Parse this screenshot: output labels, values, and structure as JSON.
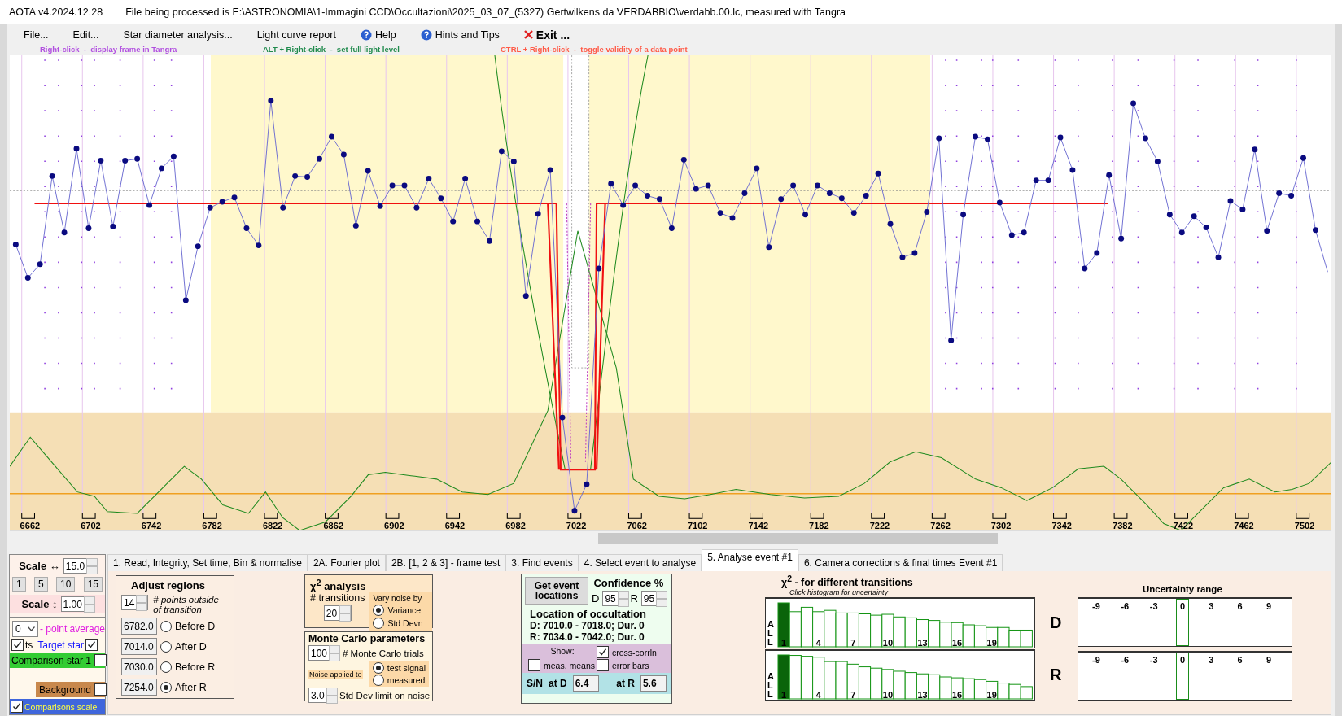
{
  "window": {
    "app": "AOTA v4.2024.12.28",
    "title": "File being processed is E:\\ASTRONOMIA\\1-Immagini CCD\\Occultazioni\\2025_03_07_(5327) Gertwilkens da VERDABBIO\\verdabb.00.lc, measured with Tangra"
  },
  "menu": [
    {
      "label": "File...",
      "kind": "plain"
    },
    {
      "label": "Edit...",
      "kind": "plain"
    },
    {
      "label": "Star diameter analysis...",
      "kind": "plain"
    },
    {
      "label": "Light curve report",
      "kind": "plain"
    },
    {
      "label": "Help",
      "kind": "help"
    },
    {
      "label": "Hints and Tips",
      "kind": "help"
    },
    {
      "label": "Exit ...",
      "kind": "exit"
    }
  ],
  "hints": [
    {
      "text": "Right-click  -  display frame in Tangra",
      "color": "#b14fe0"
    },
    {
      "text": "ALT + Right-click  -  set full light level",
      "color": "#1f8a4c"
    },
    {
      "text": "CTRL + Right-click  -  toggle validity of a data point",
      "color": "#ff5a47"
    }
  ],
  "plot": {
    "x_tick_labels": [
      "6662",
      "6702",
      "6742",
      "6782",
      "6822",
      "6862",
      "6902",
      "6942",
      "6982",
      "7022",
      "7062",
      "7102",
      "7142",
      "7182",
      "7222",
      "7262",
      "7302",
      "7342",
      "7382",
      "7422",
      "7462",
      "7502"
    ]
  },
  "left_panel": {
    "scale_h": {
      "label": "Scale ↔",
      "value": "15.0"
    },
    "scale_buttons": [
      "1",
      "5",
      "10",
      "15"
    ],
    "scale_v": {
      "label": "Scale ↕",
      "value": "1.00"
    },
    "point_average": {
      "value": "0",
      "label": "- point average"
    },
    "series": [
      {
        "kind": "pts",
        "label": "ts",
        "checked": true
      },
      {
        "kind": "target",
        "label": "Target star",
        "checked": true
      },
      {
        "kind": "comparison",
        "label": "Comparison star 1",
        "checked": false,
        "color": "#33cc33"
      },
      {
        "kind": "background",
        "label": "Background",
        "checked": false,
        "color": "#c8884c"
      },
      {
        "kind": "scaled",
        "label": "Comparisons scale",
        "checked": true,
        "color": "#3f66dc"
      }
    ]
  },
  "tabs": [
    {
      "label": "1.  Read, Integrity, Set time, Bin & normalise",
      "selected": false
    },
    {
      "label": "2A. Fourier plot",
      "selected": false
    },
    {
      "label": "2B. [1, 2 & 3] - frame test",
      "selected": false
    },
    {
      "label": "3. Find events",
      "selected": false
    },
    {
      "label": "4. Select event to analyse",
      "selected": false
    },
    {
      "label": "5. Analyse event #1",
      "selected": true
    },
    {
      "label": "6. Camera corrections & final times Event #1",
      "selected": false
    }
  ],
  "adjust_regions": {
    "title": "Adjust regions",
    "points_value": "14",
    "points_label": "# points outside of transition",
    "regions": [
      {
        "value": "6782.0",
        "label": "Before D",
        "selected": false
      },
      {
        "value": "7014.0",
        "label": "After D",
        "selected": false
      },
      {
        "value": "7030.0",
        "label": "Before R",
        "selected": false
      },
      {
        "value": "7254.0",
        "label": "After R",
        "selected": true
      }
    ]
  },
  "chi2_analysis": {
    "title": "χ$^{2}$ analysis",
    "transitions_label": "# transitions",
    "transitions_value": "20",
    "vary_label": "Vary noise by",
    "vary_options": [
      {
        "label": "Variance",
        "selected": true
      },
      {
        "label": "Std Devn",
        "selected": false
      }
    ]
  },
  "monte_carlo": {
    "title": "Monte Carlo parameters",
    "trials_value": "100",
    "trials_label": "# Monte Carlo trials",
    "noise_label": "Noise applied to",
    "noise_options": [
      {
        "label": "test signal",
        "selected": true
      },
      {
        "label": "measured",
        "selected": false
      }
    ],
    "limit_value": "3.0",
    "limit_label": "Std Dev limit on noise"
  },
  "event": {
    "button": "Get event locations",
    "confidence_label": "Confidence %",
    "d_label": "D",
    "d_value": "95",
    "r_label": "R",
    "r_value": "95",
    "location_title": "Location of occultation",
    "d_line": "D: 7010.0 - 7018.0; Dur. 0",
    "r_line": "R: 7034.0 - 7042.0; Dur. 0",
    "show_label": "Show:",
    "show_options": [
      {
        "label": "cross-corrln",
        "checked": true
      },
      {
        "label": "meas. means",
        "checked": false
      },
      {
        "label": "error bars",
        "checked": false
      }
    ],
    "sn_label": "S/N",
    "at_d_label": "at D",
    "at_d_value": "6.4",
    "at_r_label": "at R",
    "at_r_value": "5.6"
  },
  "histograms": {
    "title": "χ$^{2}$ -  for different transitions",
    "subtitle": "Click histogram for uncertainty",
    "panels": [
      {
        "side": "D",
        "all_label": "ALL",
        "bar_labels": [
          "1",
          "4",
          "7",
          "10",
          "13",
          "16",
          "19"
        ]
      },
      {
        "side": "R",
        "all_label": "ALL",
        "bar_labels": [
          "1",
          "4",
          "7",
          "10",
          "13",
          "16",
          "19"
        ]
      }
    ]
  },
  "uncertainty": {
    "title": "Uncertainty range",
    "panels": [
      {
        "ticks": [
          "-9",
          "-6",
          "-3",
          "0",
          "3",
          "6",
          "9"
        ]
      },
      {
        "ticks": [
          "-9",
          "-6",
          "-3",
          "0",
          "3",
          "6",
          "9"
        ]
      }
    ]
  }
}
